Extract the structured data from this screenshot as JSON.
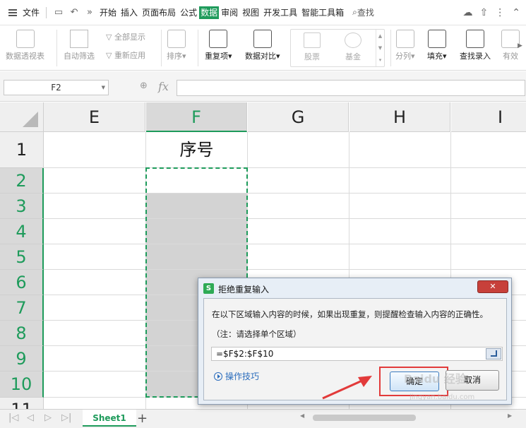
{
  "menubar": {
    "file": "文件",
    "tabs": [
      "开始",
      "插入",
      "页面布局",
      "公式",
      "数据",
      "审阅",
      "视图",
      "开发工具",
      "智能工具箱"
    ],
    "active_tab": "数据",
    "search": "查找"
  },
  "ribbon": {
    "pivot": "数据透视表",
    "autofilter": "自动筛选",
    "show_all": "全部显示",
    "reapply": "重新应用",
    "sort": "排序",
    "duplicates": "重复项",
    "compare": "数据对比",
    "stock": "股票",
    "fund": "基金",
    "split": "分列",
    "fill": "填充",
    "lookup": "查找录入",
    "valid": "有效"
  },
  "formula_bar": {
    "name_box": "F2",
    "fx": "fx",
    "value": ""
  },
  "grid": {
    "columns": [
      "E",
      "F",
      "G",
      "H",
      "I"
    ],
    "selected_column": "F",
    "rows": [
      "1",
      "2",
      "3",
      "4",
      "5",
      "6",
      "7",
      "8",
      "9",
      "10",
      "11"
    ],
    "f1_value": "序号"
  },
  "sheet_tabs": {
    "active": "Sheet1",
    "add": "+"
  },
  "dialog": {
    "title": "拒绝重复输入",
    "icon_letter": "S",
    "close": "✕",
    "description": "在以下区域输入内容的时候，如果出现重复，则提醒检查输入内容的正确性。",
    "note": "（注：请选择单个区域）",
    "range": "=$F$2:$F$10",
    "tips": "操作技巧",
    "ok": "确定",
    "cancel": "取消"
  },
  "watermark": {
    "text": "Baidu 经验",
    "url": "jingyan.baidu.com"
  },
  "colors": {
    "accent_green": "#1e9b5b",
    "highlight_red": "#e23a3a",
    "selection_gray": "#d3d3d3"
  }
}
